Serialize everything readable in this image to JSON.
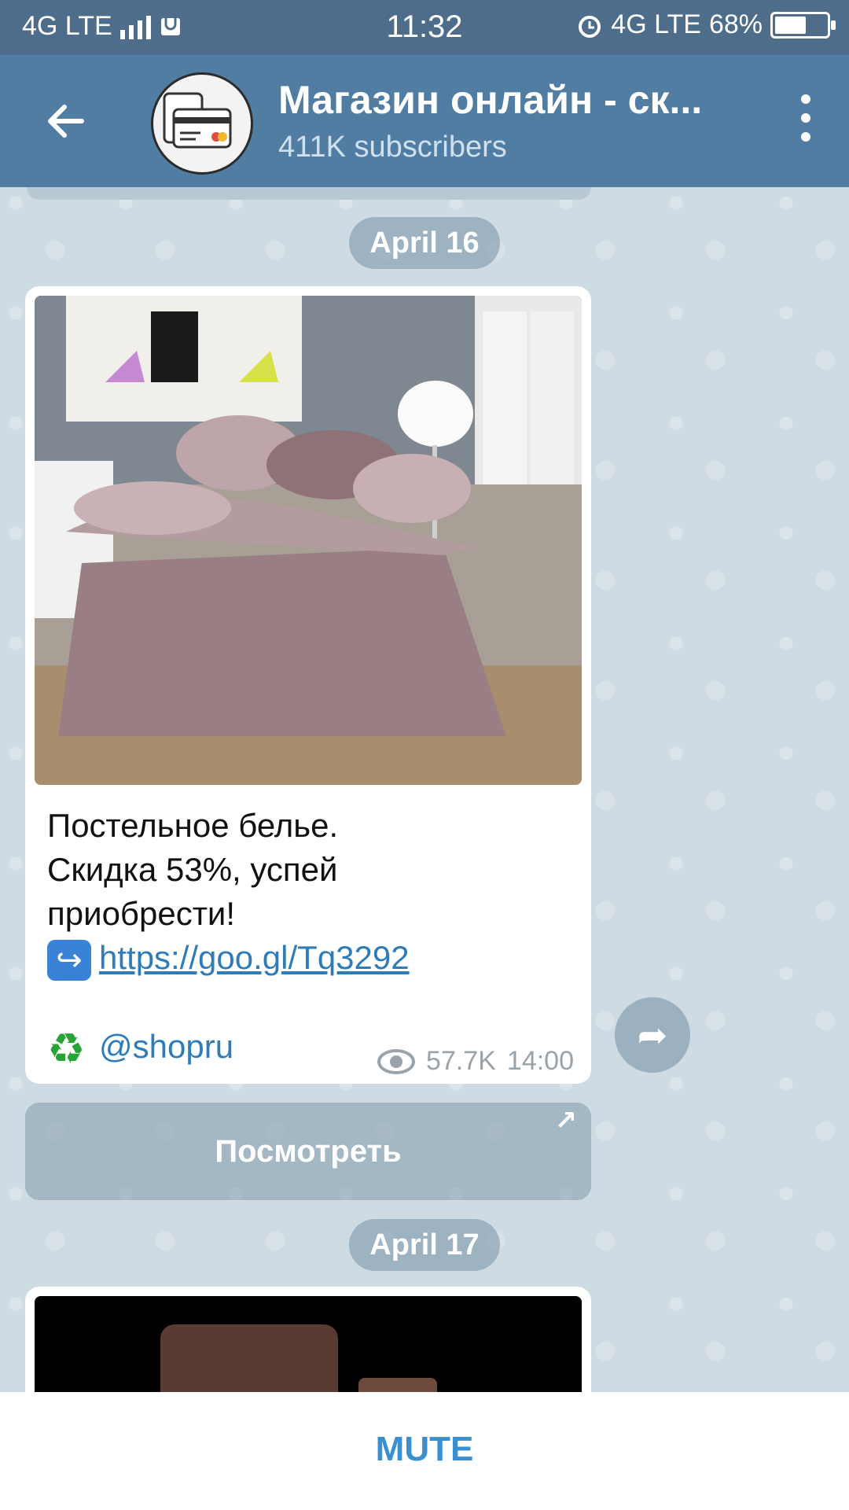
{
  "status_bar": {
    "network_left": "4G LTE",
    "time": "11:32",
    "network_right": "4G LTE",
    "battery": "68%",
    "battery_level": 0.68
  },
  "header": {
    "title": "Магазин онлайн - ск...",
    "subtitle": "411K subscribers"
  },
  "dates": [
    "April 16",
    "April 17"
  ],
  "message": {
    "text_line1": "Постельное белье.",
    "text_line2": "Скидка 53%, успей",
    "text_line3": "приобрести!",
    "link": "https://goo.gl/Tq3292",
    "handle": "@shopru",
    "views": "57.7K",
    "time": "14:00"
  },
  "view_button": {
    "label": "Посмотреть"
  },
  "bottom_bar": {
    "mute_label": "MUTE"
  },
  "icons": {
    "back": "arrow-left-icon",
    "menu": "more-vertical-icon",
    "share": "share-icon",
    "scroll": "chevron-down-icon",
    "views": "eye-icon"
  },
  "colors": {
    "header": "#527da3",
    "status_bar": "#4d6d8a",
    "chat_bg": "#cfdbe3",
    "link": "#2e7cb9",
    "mute": "#3a8fd0"
  }
}
